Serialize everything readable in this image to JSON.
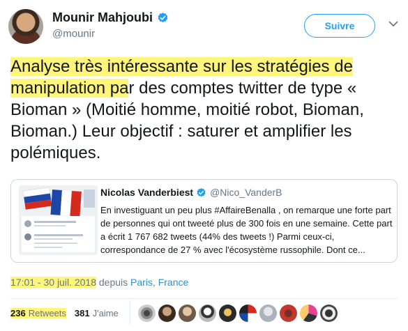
{
  "author": {
    "name": "Mounir Mahjoubi",
    "handle": "@mounir"
  },
  "follow_label": "Suivre",
  "tweet": {
    "highlight": "Analyse très intéressante sur les stratégies de manipulation pa",
    "rest": "r des comptes twitter de type « Bioman » (Moitié homme, moitié robot, Bioman, Bioman.) Leur objectif : saturer et amplifier les polémiques."
  },
  "quote": {
    "name": "Nicolas Vanderbiest",
    "handle": "@Nico_VanderB",
    "text": "En investiguant un peu plus #AffaireBenalla , on remarque une forte part de personnes qui ont tweeté plus de 300 fois en une semaine. Cette part a écrit 1 767 682 tweets (44% des tweets !) Parmi ceux-ci, correspondance de 27 % avec l'écosystème russophile. Dont ce..."
  },
  "timestamp": {
    "time": "17:01 - 30 juil. 2018",
    "from": "depuis",
    "place": "Paris, France"
  },
  "stats": {
    "retweets_count": "236",
    "retweets_label": "Retweets",
    "likes_count": "381",
    "likes_label": "J'aime"
  },
  "colors": {
    "accent": "#1da1f2",
    "highlight": "#fff57a",
    "muted": "#657786"
  },
  "icons": {
    "verified": "verified-badge-icon",
    "chevron": "chevron-down-icon"
  }
}
